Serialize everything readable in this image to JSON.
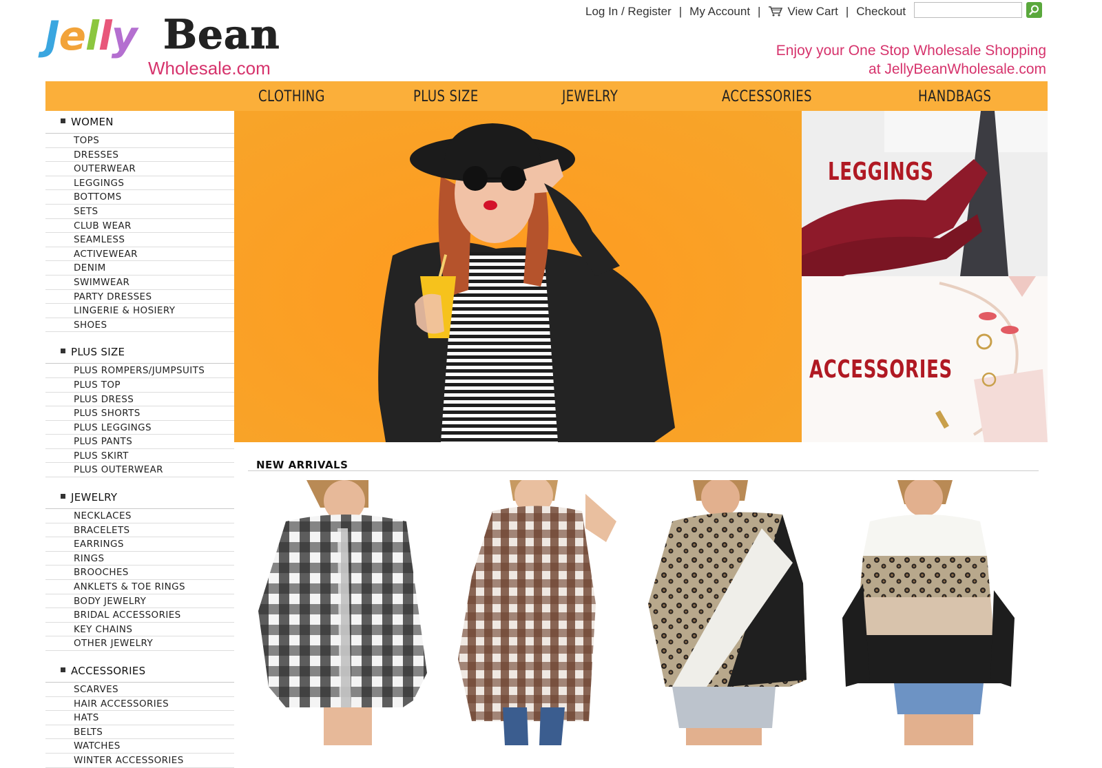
{
  "header": {
    "logo_word1_letters": [
      "J",
      "e",
      "l",
      "l",
      "y"
    ],
    "logo_word2": "Bean",
    "logo_sub": "Wholesale.com",
    "login": "Log In / Register",
    "account": "My Account",
    "cart": "View Cart",
    "checkout": "Checkout",
    "separator": "|",
    "search_value": "",
    "tagline_1": "Enjoy your One Stop Wholesale Shopping",
    "tagline_2": "at JellyBeanWholesale.com"
  },
  "nav": {
    "items": [
      "CLOTHING",
      "PLUS SIZE",
      "JEWELRY",
      "ACCESSORIES",
      "HANDBAGS"
    ]
  },
  "sidebar": {
    "sections": [
      {
        "title": "WOMEN",
        "items": [
          "TOPS",
          "DRESSES",
          "OUTERWEAR",
          "LEGGINGS",
          "BOTTOMS",
          "SETS",
          "CLUB WEAR",
          "SEAMLESS",
          "ACTIVEWEAR",
          "DENIM",
          "SWIMWEAR",
          "PARTY DRESSES",
          "LINGERIE & HOSIERY",
          "SHOES"
        ]
      },
      {
        "title": "PLUS SIZE",
        "items": [
          "PLUS ROMPERS/JUMPSUITS",
          "PLUS TOP",
          "PLUS DRESS",
          "PLUS SHORTS",
          "PLUS LEGGINGS",
          "PLUS PANTS",
          "PLUS SKIRT",
          "PLUS OUTERWEAR"
        ]
      },
      {
        "title": "JEWELRY",
        "items": [
          "NECKLACES",
          "BRACELETS",
          "EARRINGS",
          "RINGS",
          "BROOCHES",
          "ANKLETS & TOE RINGS",
          "BODY JEWELRY",
          "BRIDAL ACCESSORIES",
          "KEY CHAINS",
          "OTHER JEWELRY"
        ]
      },
      {
        "title": "ACCESSORIES",
        "items": [
          "SCARVES",
          "HAIR ACCESSORIES",
          "HATS",
          "BELTS",
          "WATCHES",
          "WINTER ACCESSORIES"
        ]
      }
    ]
  },
  "promos": {
    "leggings": "LEGGINGS",
    "accessories": "ACCESSORIES"
  },
  "new_arrivals": {
    "title": "NEW ARRIVALS"
  },
  "colors": {
    "nav_bg": "#fbaf3a",
    "brand_pink": "#d6336c",
    "hero_orange": "#f7a52a",
    "promo_red": "#b01923",
    "search_green": "#5aa83c"
  }
}
